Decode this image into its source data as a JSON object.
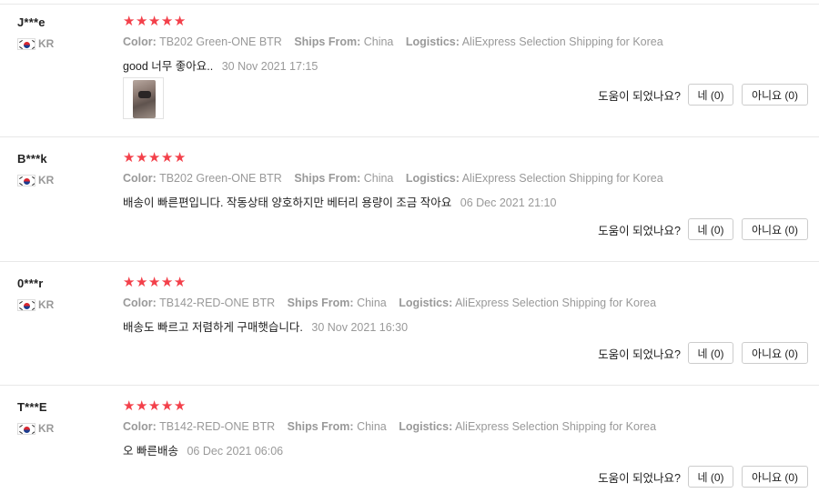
{
  "labels": {
    "color": "Color:",
    "ships_from": "Ships From:",
    "logistics": "Logistics:",
    "helpful_question": "도움이 되었나요?",
    "star_glyph": "★"
  },
  "reviews": [
    {
      "user": "J***e",
      "country": "KR",
      "rating": 5,
      "color": "TB202 Green-ONE BTR",
      "ships_from": "China",
      "logistics": "AliExpress Selection Shipping for Korea",
      "text": "good 너무 좋아요..",
      "date": "30 Nov 2021 17:15",
      "has_photo": true,
      "yes_label": "네 (0)",
      "no_label": "아니요 (0)"
    },
    {
      "user": "B***k",
      "country": "KR",
      "rating": 5,
      "color": "TB202 Green-ONE BTR",
      "ships_from": "China",
      "logistics": "AliExpress Selection Shipping for Korea",
      "text": "배송이 빠른편입니다. 작동상태 양호하지만 베터리 용량이 조금 작아요",
      "date": "06 Dec 2021 21:10",
      "has_photo": false,
      "yes_label": "네 (0)",
      "no_label": "아니요 (0)"
    },
    {
      "user": "0***r",
      "country": "KR",
      "rating": 5,
      "color": "TB142-RED-ONE BTR",
      "ships_from": "China",
      "logistics": "AliExpress Selection Shipping for Korea",
      "text": "배송도 빠르고 저렴하게 구매햇습니다.",
      "date": "30 Nov 2021 16:30",
      "has_photo": false,
      "yes_label": "네 (0)",
      "no_label": "아니요 (0)"
    },
    {
      "user": "T***E",
      "country": "KR",
      "rating": 5,
      "color": "TB142-RED-ONE BTR",
      "ships_from": "China",
      "logistics": "AliExpress Selection Shipping for Korea",
      "text": "오 빠른배송",
      "date": "06 Dec 2021 06:06",
      "has_photo": false,
      "yes_label": "네 (0)",
      "no_label": "아니요 (0)"
    }
  ]
}
